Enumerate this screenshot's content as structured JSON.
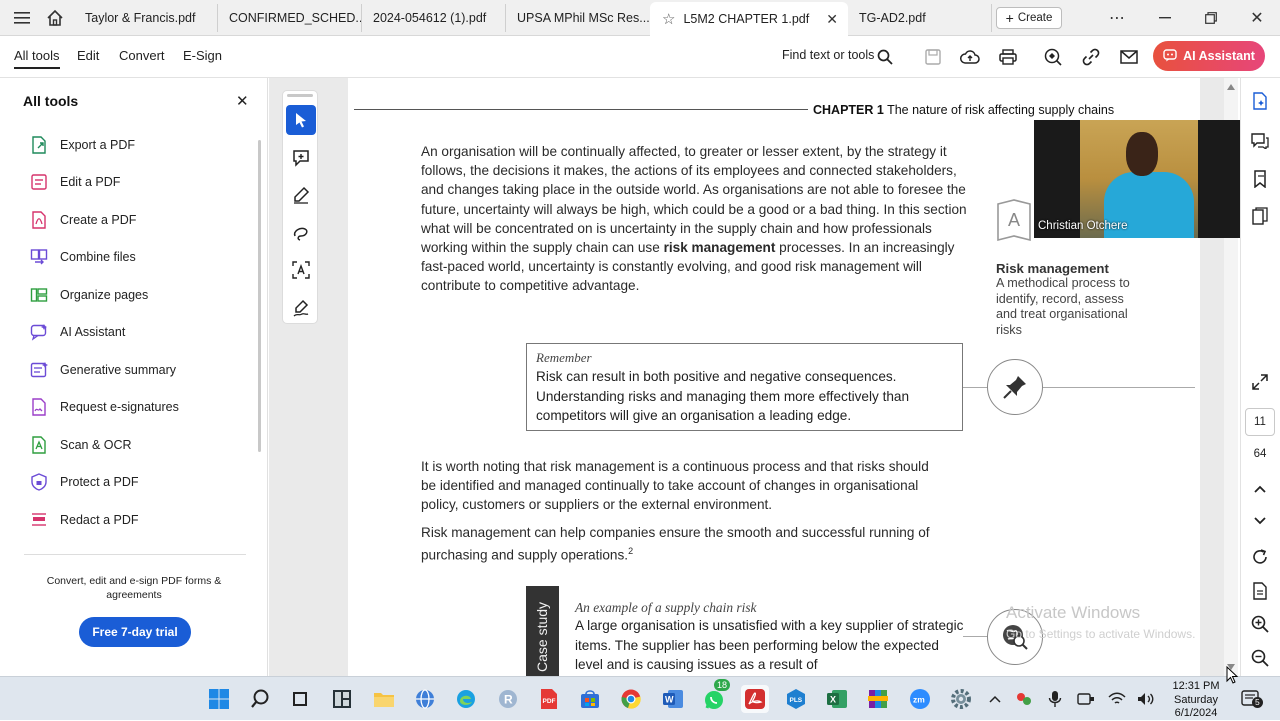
{
  "tabs": [
    {
      "label": "Taylor & Francis.pdf"
    },
    {
      "label": "CONFIRMED_SCHED..."
    },
    {
      "label": "2024-054612 (1).pdf"
    },
    {
      "label": "UPSA MPhil MSc Res..."
    },
    {
      "label": "L5M2 CHAPTER 1.pdf"
    },
    {
      "label": "TG-AD2.pdf"
    }
  ],
  "create_label": "Create",
  "menu": {
    "all_tools": "All tools",
    "edit": "Edit",
    "convert": "Convert",
    "esign": "E-Sign"
  },
  "find_label": "Find text or tools",
  "ai_label": "AI Assistant",
  "panel": {
    "title": "All tools",
    "items": [
      {
        "label": "Export a PDF"
      },
      {
        "label": "Edit a PDF"
      },
      {
        "label": "Create a PDF"
      },
      {
        "label": "Combine files"
      },
      {
        "label": "Organize pages"
      },
      {
        "label": "AI Assistant"
      },
      {
        "label": "Generative summary"
      },
      {
        "label": "Request e-signatures"
      },
      {
        "label": "Scan & OCR"
      },
      {
        "label": "Protect a PDF"
      },
      {
        "label": "Redact a PDF"
      }
    ],
    "promo": "Convert, edit and e-sign PDF forms & agreements",
    "trial": "Free 7-day trial"
  },
  "doc": {
    "chapter_num": "CHAPTER 1",
    "chapter_title": "The nature of risk affecting supply chains",
    "para1": "An organisation will be continually affected, to greater or lesser extent, by the strategy it follows, the decisions it makes, the actions of its employees and connected stakeholders, and changes taking place in the outside world. As organisations are not able to foresee the future, uncertainty will always be high, which could be a good or a bad thing. In this section what will be concentrated on is uncertainty in the supply chain and how professionals working within the supply chain can use",
    "para1_bold": "risk management",
    "para1_end": "processes. In an increasingly fast-paced world, uncertainty is constantly evolving, and good risk management will contribute to competitive advantage.",
    "remember_title": "Remember",
    "remember_body": "Risk can result in both positive and negative consequences. Understanding risks and managing them more effectively than competitors will give an organisation a leading edge.",
    "side_title": "Risk management",
    "side_body": "A methodical process to identify, record, assess and treat organisational risks",
    "para2": "It is worth noting that risk management is a continuous process and that risks should be identified and managed continually to take account of changes in organisational policy, customers or suppliers or the external environment.",
    "para3": "Risk management can help companies ensure the smooth and successful running of purchasing and supply operations.",
    "para3_sup": "2",
    "case_tab": "Case study",
    "case_title": "An example of a supply chain risk",
    "case_body": "A large organisation is unsatisfied with a key supplier of strategic items. The supplier has been performing below the expected level and is causing issues as a result of"
  },
  "webcam_name": "Christian Otchere",
  "page_current": "11",
  "page_total": "64",
  "watermark_title": "Activate Windows",
  "watermark_sub": "Go to Settings to activate Windows.",
  "clock": {
    "time": "12:31 PM",
    "day": "Saturday",
    "date": "6/1/2024"
  },
  "taskbar_badge": "18",
  "notif_count": "5",
  "colors": {
    "accent": "#1a5dd6",
    "ai_gradient_start": "#e8513e",
    "ai_gradient_end": "#e7467a"
  }
}
